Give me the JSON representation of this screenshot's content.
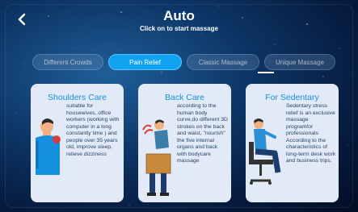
{
  "header": {
    "title": "Auto",
    "subtitle": "Click on to start massage"
  },
  "tabs": [
    {
      "label": "Different Crowds",
      "state": "inactive"
    },
    {
      "label": "Pain Relief",
      "state": "active"
    },
    {
      "label": "Classic Massage",
      "state": "inactive"
    },
    {
      "label": "Unique Massage",
      "state": "inactive"
    }
  ],
  "cards": [
    {
      "title": "Shoulders Care",
      "text": "suitable for housewives, office workers (working with computer in a long constantly time ) and people over 35 years old, improve sleep, relieve dizziness",
      "icon": "shoulder-pain-figure"
    },
    {
      "title": "Back Care",
      "text": "according to the human body curve,do different 3D strokes on the back and waist, \"nourish\" the five internal organs and back with bodycare massage",
      "icon": "back-pain-figure"
    },
    {
      "title": "For Sedentary",
      "text": "Sedentary stress relief is an exclusive massage programfor professionals According to the characteristics of long-term desk work and business trips.",
      "icon": "sedentary-chair-figure"
    }
  ],
  "colors": {
    "accent": "#12a2f2",
    "card_bg": "#e1eaf6",
    "card_title": "#1590de"
  }
}
